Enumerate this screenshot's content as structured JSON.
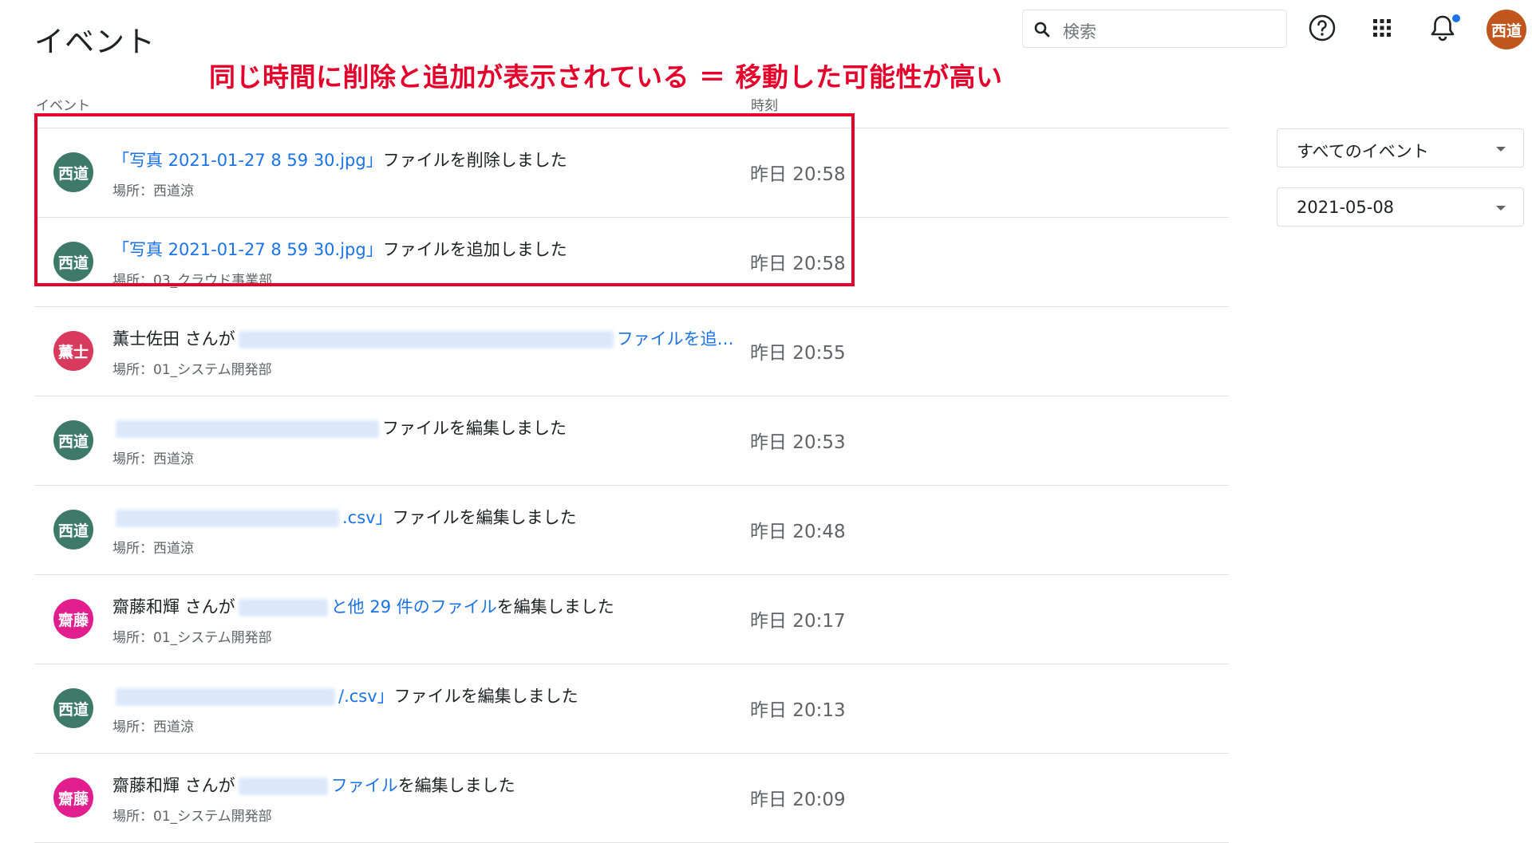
{
  "header": {
    "title": "イベント",
    "annotation": "同じ時間に削除と追加が表示されている ＝ 移動した可能性が高い",
    "search_placeholder": "検索",
    "user_avatar": "西道"
  },
  "columns": {
    "event": "イベント",
    "time": "時刻"
  },
  "filters": {
    "event_type": "すべてのイベント",
    "date": "2021-05-08"
  },
  "events": [
    {
      "avatar": "西道",
      "link": "「写真 2021-01-27 8 59 30.jpg」",
      "action": "ファイルを削除しました",
      "location": "場所：西道涼",
      "time": "昨日 20:58"
    },
    {
      "avatar": "西道",
      "link": "「写真 2021-01-27 8 59 30.jpg」",
      "action": "ファイルを追加しました",
      "location": "場所：03_クラウド事業部",
      "time": "昨日 20:58"
    },
    {
      "avatar": "薫士",
      "actor": "薫士佐田 さんが",
      "link": "ファイルを追…",
      "location": "場所：01_システム開発部",
      "time": "昨日 20:55"
    },
    {
      "avatar": "西道",
      "action": "ファイルを編集しました",
      "location": "場所：西道涼",
      "time": "昨日 20:53"
    },
    {
      "avatar": "西道",
      "link": ".csv」",
      "action": "ファイルを編集しました",
      "location": "場所：西道涼",
      "time": "昨日 20:48"
    },
    {
      "avatar": "齋藤",
      "actor": "齋藤和輝 さんが",
      "link": "と他 29 件のファイル",
      "action": "を編集しました",
      "location": "場所：01_システム開発部",
      "time": "昨日 20:17"
    },
    {
      "avatar": "西道",
      "link": "/.csv」",
      "action": "ファイルを編集しました",
      "location": "場所：西道涼",
      "time": "昨日 20:13"
    },
    {
      "avatar": "齋藤",
      "actor": "齋藤和輝 さんが",
      "link": "ファイル",
      "action": "を編集しました",
      "location": "場所：01_システム開発部",
      "time": "昨日 20:09"
    }
  ]
}
